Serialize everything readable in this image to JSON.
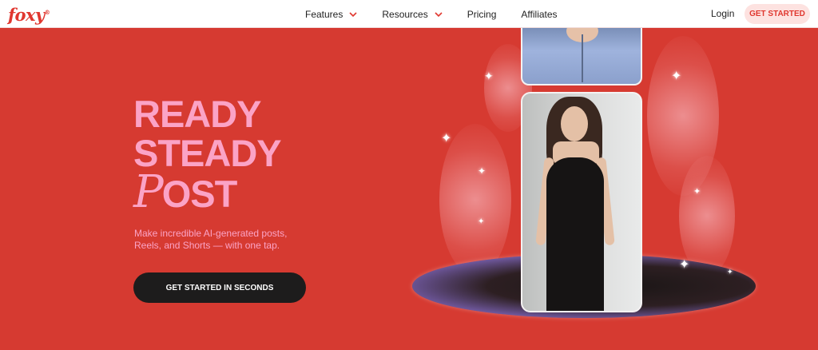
{
  "header": {
    "logo": "foxy",
    "logo_mark": "®",
    "nav": [
      {
        "label": "Features",
        "has_dropdown": true
      },
      {
        "label": "Resources",
        "has_dropdown": true
      },
      {
        "label": "Pricing",
        "has_dropdown": false
      },
      {
        "label": "Affiliates",
        "has_dropdown": false
      }
    ],
    "login": "Login",
    "cta": "GET STARTED"
  },
  "hero": {
    "title_line1": "READY",
    "title_line2": "STEADY",
    "title_script": "P",
    "title_rest": "OST",
    "subtitle": "Make incredible AI-generated posts, Reels, and Shorts — with one tap.",
    "cta": "GET STARTED IN SECONDS"
  },
  "colors": {
    "background": "#d63a31",
    "accent_pink": "#fba3c6",
    "brand_red": "#e0372f",
    "cta_dark": "#1d1c1c"
  },
  "icons": {
    "dropdown": "chevron-down-icon",
    "sparkle": "sparkle-icon"
  }
}
